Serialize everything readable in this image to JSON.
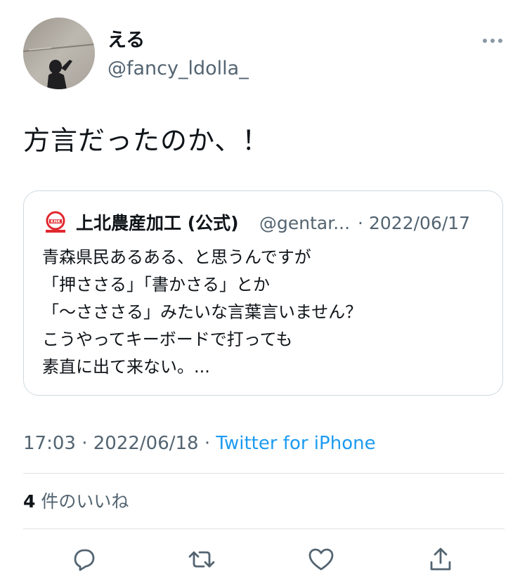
{
  "author": {
    "display_name": "える",
    "handle": "@fancy_ldolla_",
    "avatar_icon": "avatar-shadow-photo"
  },
  "tweet": {
    "text": "方言だったのか、！",
    "time": "17:03",
    "date": "2022/06/18",
    "source": "Twitter for iPhone",
    "separator": "·"
  },
  "quoted": {
    "logo_icon": "knk-logo-icon",
    "logo_text": "KNK",
    "display_name": "上北農産加工 (公式)",
    "handle": "@gentar...",
    "separator": "·",
    "date": "2022/06/17",
    "lines": [
      "青森県民あるある、と思うんですが",
      "「押ささる」「書かさる」とか",
      "「〜さささる」みたいな言葉言いません？",
      "こうやってキーボードで打っても",
      "素直に出て来ない。..."
    ]
  },
  "stats": {
    "likes_count": "4",
    "likes_label": "件のいいね"
  },
  "actions": {
    "reply_icon": "reply-icon",
    "retweet_icon": "retweet-icon",
    "like_icon": "like-icon",
    "share_icon": "share-icon"
  },
  "colors": {
    "text": "#0f1419",
    "secondary": "#536471",
    "link": "#1d9bf0",
    "border": "#cfd9de",
    "logo_red": "#e0282e"
  }
}
